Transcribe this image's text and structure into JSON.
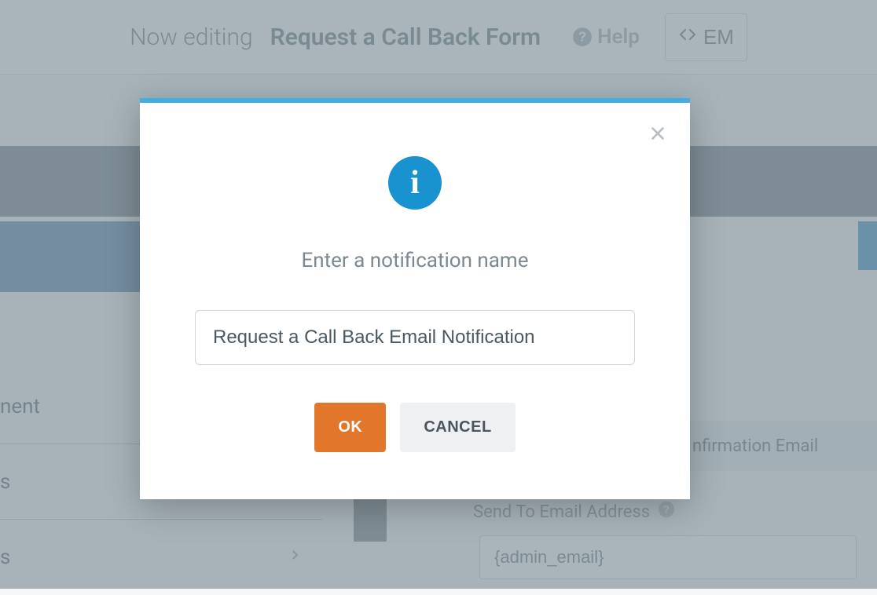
{
  "header": {
    "editing_prefix": "Now editing",
    "form_name": "Request a Call Back Form",
    "help_label": "Help",
    "embed_label": "EM"
  },
  "sidebar": {
    "items": [
      {
        "label_fragment": "nent"
      },
      {
        "label_fragment": "s"
      },
      {
        "label_fragment": "s"
      }
    ]
  },
  "right": {
    "confirmation_tab_fragment": "nfirmation Email",
    "send_to_label": "Send To Email Address",
    "send_to_value": "{admin_email}"
  },
  "modal": {
    "prompt": "Enter a notification name",
    "input_value": "Request a Call Back Email Notification",
    "ok_label": "OK",
    "cancel_label": "CANCEL",
    "info_glyph": "i"
  }
}
